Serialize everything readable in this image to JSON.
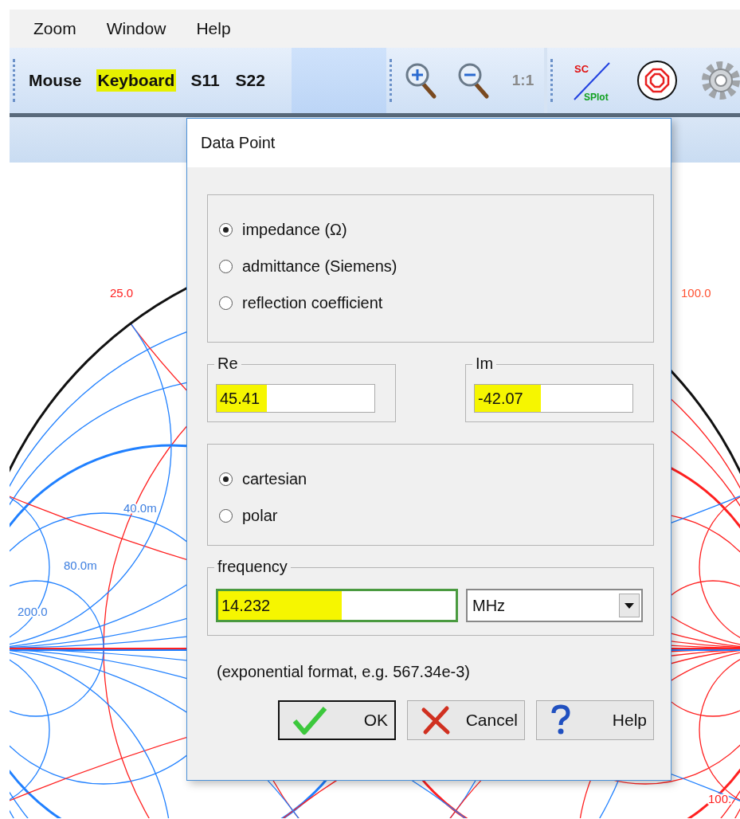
{
  "menu": [
    {
      "label": "Zoom"
    },
    {
      "label": "Window"
    },
    {
      "label": "Help"
    }
  ],
  "toolbar": {
    "modes": [
      {
        "label": "Mouse",
        "highlighted": false
      },
      {
        "label": "Keyboard",
        "highlighted": true
      },
      {
        "label": "S11",
        "highlighted": false
      },
      {
        "label": "S22",
        "highlighted": false
      }
    ],
    "scale_label": "1:1",
    "splot": {
      "top": "SC",
      "bottom": "SPlot"
    }
  },
  "chart_labels": [
    {
      "text": "25.0",
      "color": "#ff2020"
    },
    {
      "text": "100.0",
      "color": "#ff5030"
    },
    {
      "text": "40.0m",
      "color": "#3c7ee0"
    },
    {
      "text": "80.0m",
      "color": "#3c7ee0"
    },
    {
      "text": "200.0",
      "color": "#3c7ee0"
    },
    {
      "text": "100.",
      "color": "#ff2020"
    }
  ],
  "dialog": {
    "title": "Data Point",
    "representation": [
      {
        "label": "impedance (Ω)",
        "selected": true
      },
      {
        "label": "admittance (Siemens)",
        "selected": false
      },
      {
        "label": "reflection coefficient",
        "selected": false
      }
    ],
    "re": {
      "label": "Re",
      "value": "45.41",
      "highlighted": true
    },
    "im": {
      "label": "Im",
      "value": "-42.07",
      "highlighted": true
    },
    "format": [
      {
        "label": "cartesian",
        "selected": true
      },
      {
        "label": "polar",
        "selected": false
      }
    ],
    "frequency": {
      "label": "frequency",
      "value": "14.232",
      "highlighted": true,
      "focused": true
    },
    "unit": "MHz",
    "hint": "(exponential format, e.g. 567.34e-3)",
    "buttons": [
      {
        "label": "OK",
        "kind": "ok",
        "default": true
      },
      {
        "label": "Cancel",
        "kind": "cancel",
        "default": false
      },
      {
        "label": "Help",
        "kind": "help",
        "default": false
      }
    ]
  }
}
